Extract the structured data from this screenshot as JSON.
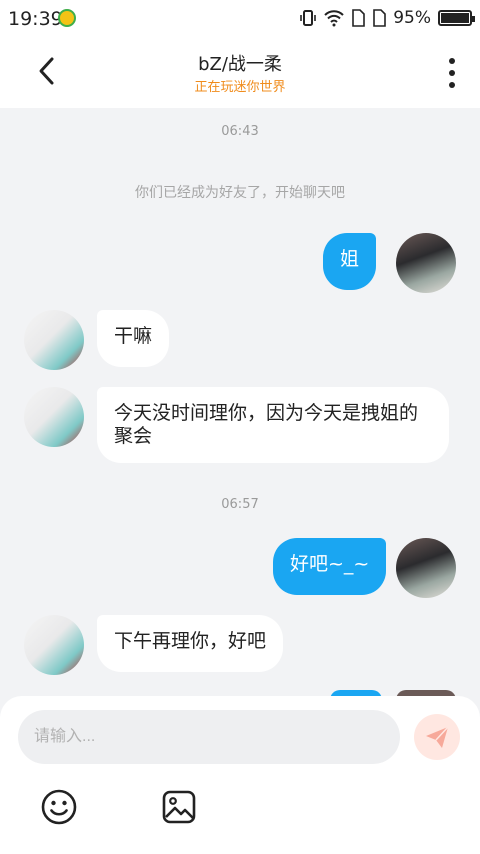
{
  "status_bar": {
    "time": "19:39",
    "battery_percent": "95%"
  },
  "header": {
    "title": "bZ/战一柔",
    "subtitle": "正在玩迷你世界"
  },
  "timestamps": [
    "06:43",
    "06:57"
  ],
  "system_message": "你们已经成为好友了，开始聊天吧",
  "messages": [
    {
      "side": "right",
      "text": "姐"
    },
    {
      "side": "left",
      "text": "干嘛"
    },
    {
      "side": "left",
      "line1": "今天没时间理你，因为今天是拽姐的",
      "line2": "聚会"
    },
    {
      "side": "right",
      "text": "好吧~_~"
    },
    {
      "side": "left",
      "text": "下午再理你，好吧"
    }
  ],
  "input": {
    "placeholder": "请输入..."
  },
  "icons": {
    "back": "chevron-left-icon",
    "more": "more-vertical-icon",
    "send": "send-icon",
    "emoji": "emoji-icon",
    "image": "image-icon"
  },
  "colors": {
    "accent_bubble": "#1aa6f2",
    "subtitle": "#f08c1c",
    "background": "#f2f3f5"
  }
}
